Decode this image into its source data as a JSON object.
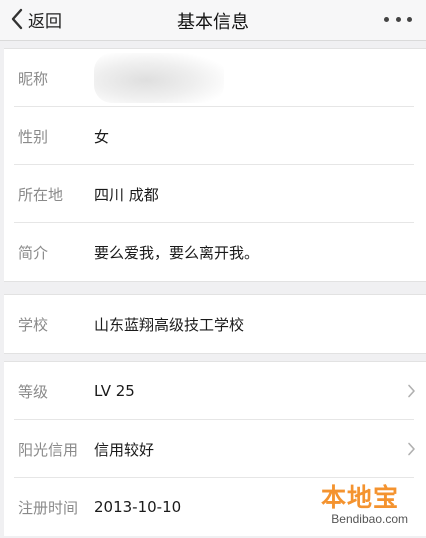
{
  "navbar": {
    "back_label": "返回",
    "title": "基本信息"
  },
  "profile": {
    "nickname_label": "昵称",
    "gender_label": "性别",
    "gender_value": "女",
    "location_label": "所在地",
    "location_value": "四川 成都",
    "bio_label": "简介",
    "bio_value": "要么爱我，要么离开我。"
  },
  "school": {
    "label": "学校",
    "value": "山东蓝翔高级技工学校"
  },
  "account": {
    "level_label": "等级",
    "level_value": "LV 25",
    "credit_label": "阳光信用",
    "credit_value": "信用较好",
    "register_label": "注册时间",
    "register_value": "2013-10-10"
  },
  "watermark": {
    "logo_text": "本地宝",
    "url_text": "Bendibao.com"
  },
  "colors": {
    "label": "#8a8a8a",
    "value": "#1a1a1a",
    "background": "#f0f0f2",
    "watermark": "#f4932f"
  }
}
